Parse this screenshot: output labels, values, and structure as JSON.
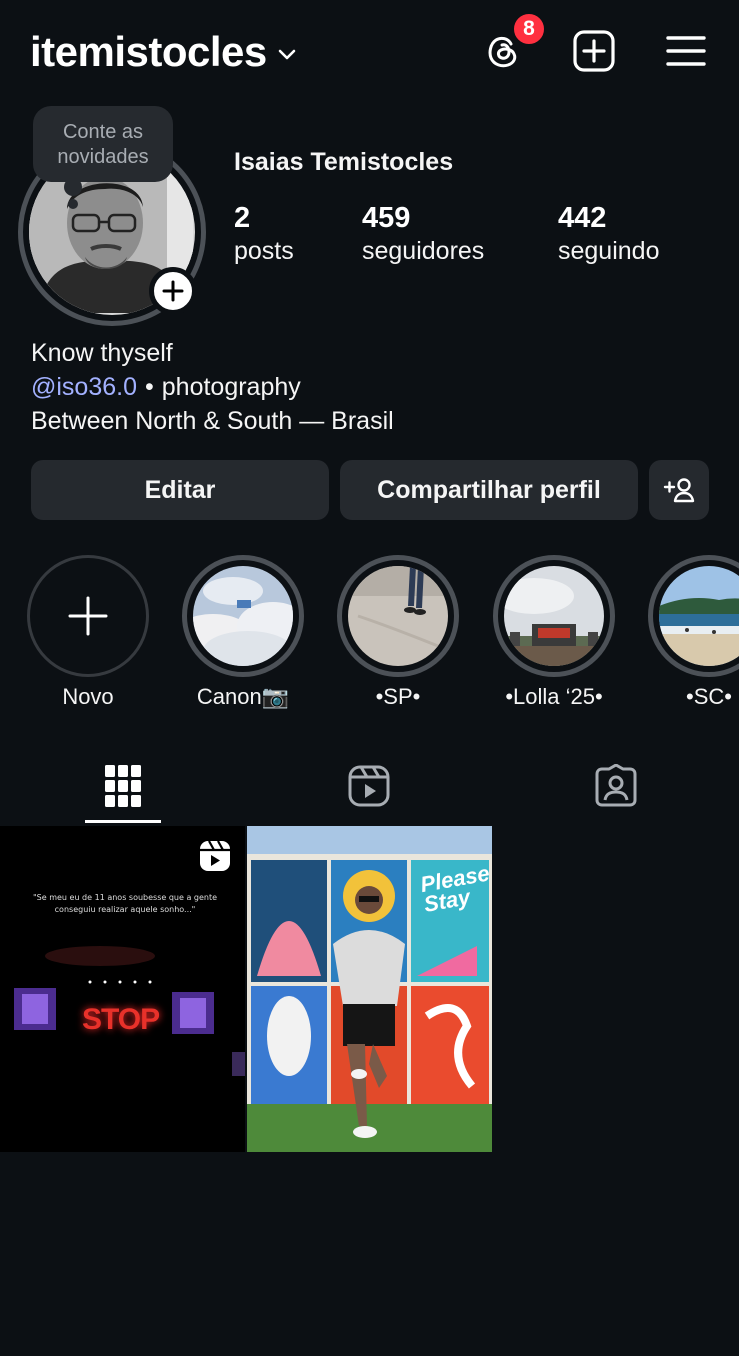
{
  "header": {
    "username": "itemistocles",
    "threads_badge_count": "8"
  },
  "note": {
    "text": "Conte as novidades"
  },
  "profile": {
    "full_name": "Isaias Temistocles",
    "stats": [
      {
        "value": "2",
        "label": "posts"
      },
      {
        "value": "459",
        "label": "seguidores"
      },
      {
        "value": "442",
        "label": "seguindo"
      }
    ],
    "bio": {
      "line1": "Know thyself",
      "mention": "@iso36.0",
      "separator": "•",
      "category": "photography",
      "line3": "Between North & South — Brasil"
    }
  },
  "actions": {
    "edit_label": "Editar",
    "share_label": "Compartilhar perfil"
  },
  "highlights": [
    {
      "label": "Novo"
    },
    {
      "label": "Canon📷"
    },
    {
      "label": "•SP•"
    },
    {
      "label": "•Lolla ‘25•"
    },
    {
      "label": "•SC•"
    }
  ],
  "tabs": [
    {
      "name": "grid",
      "icon": "grid-icon",
      "active": true
    },
    {
      "name": "reels",
      "icon": "reels-icon",
      "active": false
    },
    {
      "name": "tagged",
      "icon": "tagged-icon",
      "active": false
    }
  ],
  "posts": [
    {
      "type": "reel",
      "caption": "\"Se meu eu de 11 anos soubesse que a gente conseguiu realizar aquele sonho...\"",
      "sign_text": "STOP"
    },
    {
      "type": "photo",
      "poster_text": "Please Stay"
    }
  ],
  "colors": {
    "background": "#0c1014",
    "button": "#25292e",
    "link": "#a3b1ff",
    "badge": "#ff3040"
  }
}
